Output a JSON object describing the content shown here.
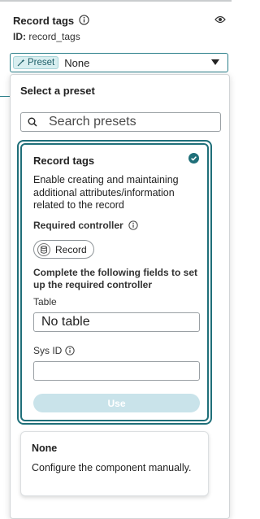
{
  "colors": {
    "accent": "#1f6f79",
    "chip_bg": "#d8eef0",
    "use_button_bg": "#c9e3ea"
  },
  "header": {
    "title": "Record tags",
    "id_label": "ID:",
    "id_value": "record_tags",
    "title_info_icon": "info-icon",
    "visibility_icon": "eye-icon"
  },
  "preset_select": {
    "chip_icon": "wand-icon",
    "chip_label": "Preset",
    "value": "None",
    "caret_icon": "caret-down-icon"
  },
  "dropdown": {
    "title": "Select a preset",
    "search": {
      "placeholder": "Search presets",
      "value": "",
      "icon": "search-icon"
    },
    "presets": [
      {
        "title": "Record tags",
        "selected": true,
        "description": "Enable creating and maintaining additional attributes/information related to the record",
        "required_controller_label": "Required controller",
        "controller": {
          "icon": "database-icon",
          "label": "Record"
        },
        "instructions": "Complete the following fields to set up the required controller",
        "fields": [
          {
            "label": "Table",
            "value": "No table"
          },
          {
            "label": "Sys ID",
            "value": ""
          }
        ],
        "button_label": "Use"
      },
      {
        "title": "None",
        "description": "Configure the component manually."
      }
    ]
  }
}
